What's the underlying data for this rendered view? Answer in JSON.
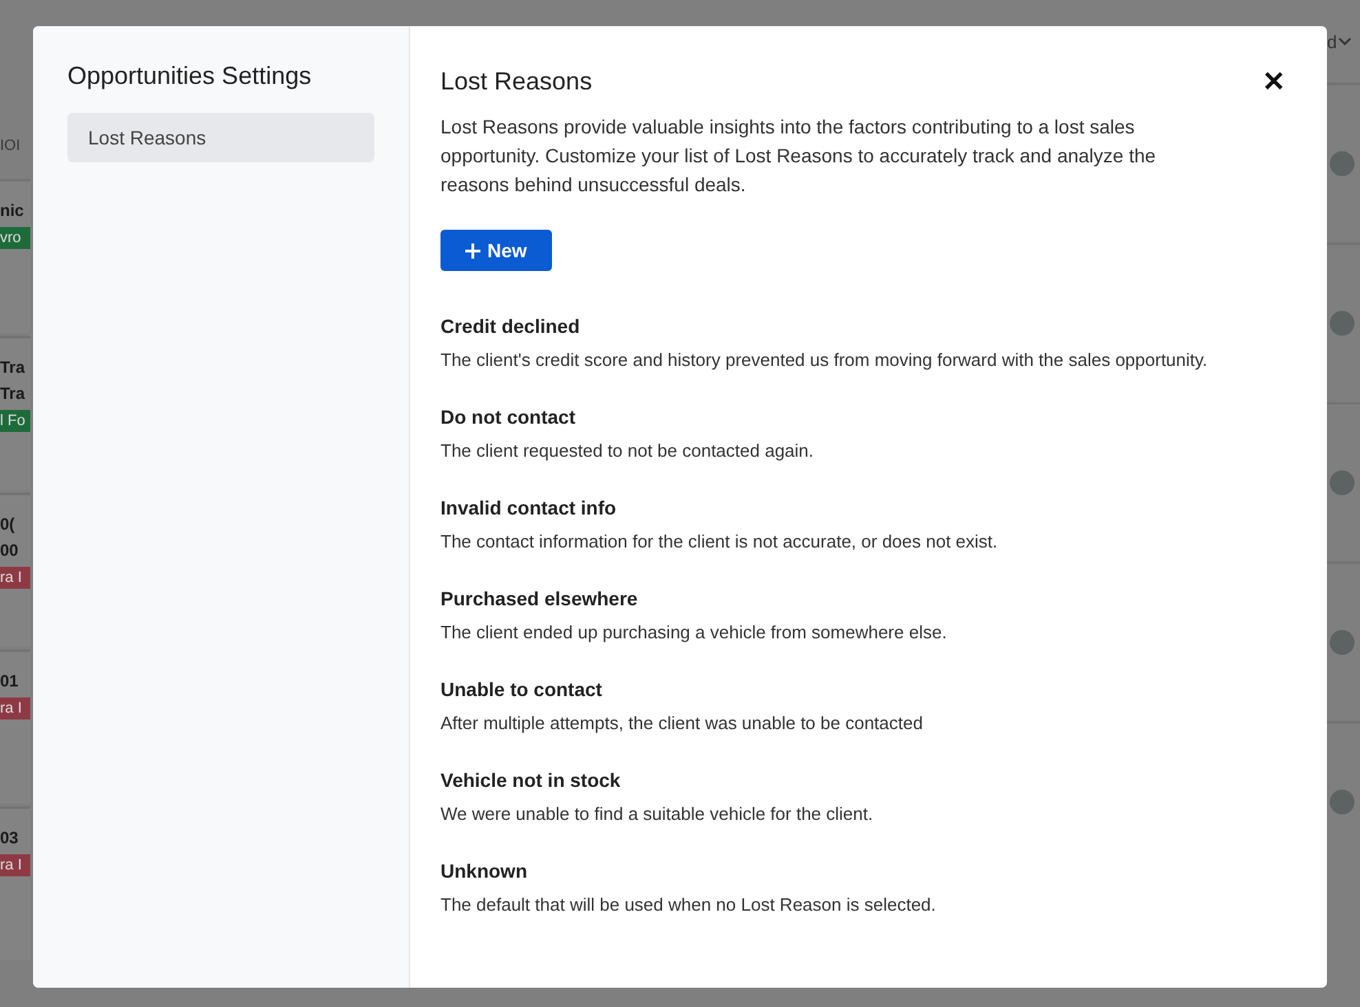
{
  "background": {
    "left_fragments": [
      {
        "text": "IOI",
        "kind": "header"
      },
      {
        "text": "nic",
        "kind": "line"
      },
      {
        "text": "vro",
        "kind": "tag",
        "color": "#1e6b3a"
      },
      {
        "text": "Tra",
        "kind": "line"
      },
      {
        "text": "Tra",
        "kind": "line"
      },
      {
        "text": "l Fo",
        "kind": "tag",
        "color": "#1e6b3a"
      },
      {
        "text": "0(",
        "kind": "line"
      },
      {
        "text": "00",
        "kind": "line"
      },
      {
        "text": "ra I",
        "kind": "tag",
        "color": "#8e3a45"
      },
      {
        "text": "01",
        "kind": "line"
      },
      {
        "text": "ra I",
        "kind": "tag",
        "color": "#8e3a45"
      },
      {
        "text": "03",
        "kind": "line"
      },
      {
        "text": "ra I",
        "kind": "tag",
        "color": "#8e3a45"
      }
    ],
    "top_right": "d"
  },
  "sidebar": {
    "title": "Opportunities Settings",
    "items": [
      {
        "label": "Lost Reasons",
        "selected": true
      }
    ]
  },
  "main": {
    "title": "Lost Reasons",
    "close": "✕",
    "description": "Lost Reasons provide valuable insights into the factors contributing to a lost sales opportunity. Customize your list of Lost Reasons to accurately track and analyze the reasons behind unsuccessful deals.",
    "new_button": "New",
    "reasons": [
      {
        "name": "Credit declined",
        "description": "The client's credit score and history prevented us from moving forward with the sales opportunity."
      },
      {
        "name": "Do not contact",
        "description": "The client requested to not be contacted again."
      },
      {
        "name": "Invalid contact info",
        "description": "The contact information for the client is not accurate, or does not exist."
      },
      {
        "name": "Purchased elsewhere",
        "description": "The client ended up purchasing a vehicle from somewhere else."
      },
      {
        "name": "Unable to contact",
        "description": "After multiple attempts, the client was unable to be contacted"
      },
      {
        "name": "Vehicle not in stock",
        "description": "We were unable to find a suitable vehicle for the client."
      },
      {
        "name": "Unknown",
        "description": "The default that will be used when no Lost Reason is selected."
      }
    ]
  }
}
